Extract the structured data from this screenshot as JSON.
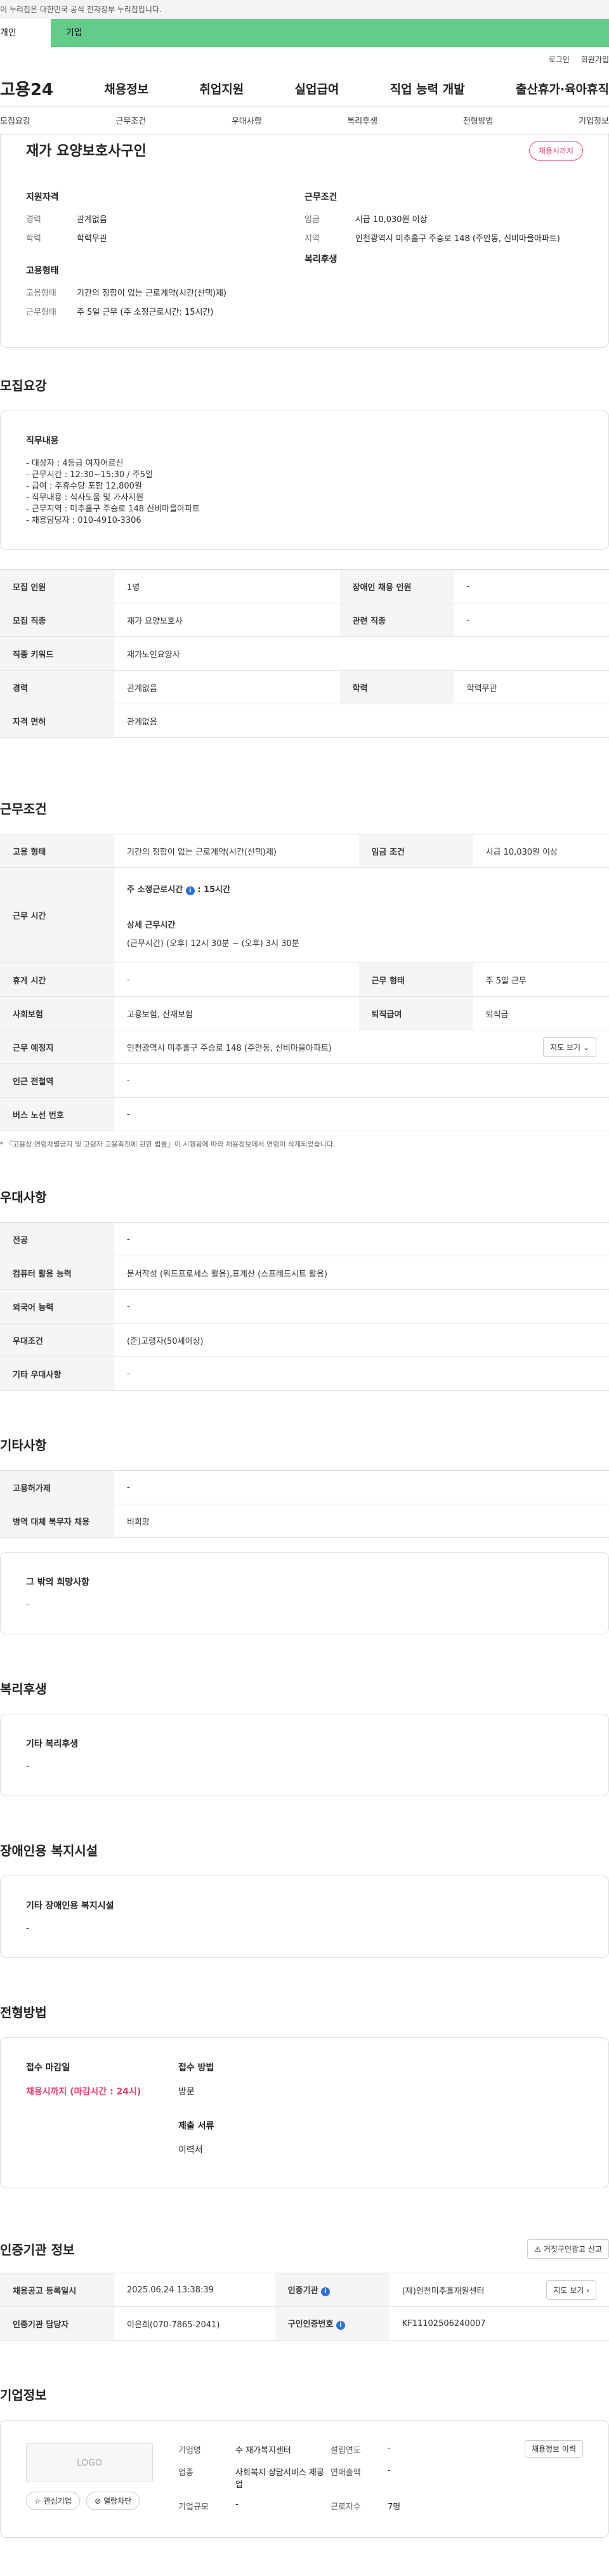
{
  "gov_bar": "이 누리집은 대한민국 공식 전자정부 누리집입니다.",
  "tabs": {
    "personal": "개인",
    "company": "기업"
  },
  "util": {
    "login": "로그인",
    "signup": "회원가입"
  },
  "gnb": {
    "logo": "고용24",
    "items": [
      "채용정보",
      "취업지원",
      "실업급여",
      "직업 능력 개발",
      "출산휴가·육아휴직"
    ]
  },
  "snb": [
    "모집요강",
    "근무조건",
    "우대사항",
    "복리후생",
    "전형방법",
    "기업정보"
  ],
  "summary": {
    "title": "재가 요양보호사구인",
    "badge": "채용시까지",
    "qual_title": "지원자격",
    "qual": [
      {
        "k": "경력",
        "v": "관계없음"
      },
      {
        "k": "학력",
        "v": "학력무관"
      }
    ],
    "cond_title": "근무조건",
    "cond": [
      {
        "k": "임금",
        "v": "시급 10,030원 이상"
      },
      {
        "k": "지역",
        "v": "인천광역시 미추홀구 주승로 148 (주안동, 신비마을아파트)"
      }
    ],
    "emp_title": "고용형태",
    "emp": [
      {
        "k": "고용형태",
        "v": "기간의 정함이 없는 근로계약(시간(선택)제)"
      },
      {
        "k": "근무형태",
        "v": "주 5일 근무 (주 소정근로시간: 15시간)"
      }
    ],
    "welfare_title": "복리후생"
  },
  "recruit": {
    "section": "모집요강",
    "desc_title": "직무내용",
    "desc_lines": [
      "- 대상자 : 4등급 여자어르신",
      "- 근무시간 : 12:30~15:30 / 주5일",
      "- 급여 : 주휴수당 포함 12,800원",
      "- 직무내용 :  식사도움 및 가사지원",
      "- 근무지역 : 미추홀구 주승로 148 신비마을아파트",
      "- 채용담당자 : 010-4910-3306"
    ],
    "table": {
      "headcount_k": "모집 인원",
      "headcount_v": "1명",
      "disabled_k": "장애인 채용 인원",
      "disabled_v": "-",
      "job_k": "모집 직종",
      "job_v": "재가 요양보호사",
      "related_k": "관련 직종",
      "related_v": "-",
      "keyword_k": "직종 키워드",
      "keyword_v": "재가노인요양사",
      "career_k": "경력",
      "career_v": "관계없음",
      "edu_k": "학력",
      "edu_v": "학력무관",
      "license_k": "자격 면허",
      "license_v": "관계없음"
    }
  },
  "work": {
    "section": "근무조건",
    "emp_k": "고용 형태",
    "emp_v": "기간의 정함이 없는 근로계약(시간(선택)제)",
    "wage_k": "임금 조건",
    "wage_v": "시급 10,030원 이상",
    "hours_k": "근무 시간",
    "weekly_label": "주 소정근로시간",
    "weekly_value": "15시간",
    "detail_label": "상세 근무시간",
    "detail_value": "(근무시간) (오후) 12시 30분 ~ (오후) 3시 30분",
    "break_k": "휴게 시간",
    "break_v": "-",
    "type_k": "근무 형태",
    "type_v": "주 5일 근무",
    "insurance_k": "사회보험",
    "insurance_v": "고용보험, 산재보험",
    "severance_k": "퇴직급여",
    "severance_v": "퇴직금",
    "place_k": "근무 예정지",
    "place_v": "인천광역시 미추홀구 주승로 148 (주안동, 신비마을아파트)",
    "map_btn": "지도 보기",
    "station_k": "인근 전철역",
    "station_v": "-",
    "bus_k": "버스 노선 번호",
    "bus_v": "-",
    "note": "* 『고용상 연령차별금지 및 고령자 고용촉진에 관한 법률』이 시행됨에 따라 채용정보에서 연령이 삭제되었습니다."
  },
  "pref": {
    "section": "우대사항",
    "major_k": "전공",
    "major_v": "-",
    "computer_k": "컴퓨터 활용 능력",
    "computer_v": "문서작성 (워드프로세스 활용),표계산 (스프레드시트 활용)",
    "lang_k": "외국어 능력",
    "lang_v": "-",
    "cond_k": "우대조건",
    "cond_v": "(준)고령자(50세이상)",
    "etc_k": "기타 우대사항",
    "etc_v": "-"
  },
  "other": {
    "section": "기타사항",
    "foreign_k": "고용허가제",
    "foreign_v": "-",
    "military_k": "병역 대체 복무자 채용",
    "military_v": "비희망",
    "wish_title": "그 밖의 희망사항",
    "wish_v": "-"
  },
  "welfare": {
    "section": "복리후생",
    "title": "기타 복리후생",
    "value": "-"
  },
  "facility": {
    "section": "장애인용 복지시설",
    "title": "기타 장애인용 복지시설",
    "value": "-"
  },
  "selection": {
    "section": "전형방법",
    "deadline_label": "접수 마감일",
    "deadline_value": "채용시까지 (마감시간 : 24시)",
    "method_label": "접수 방법",
    "method_value": "방문",
    "docs_label": "제출 서류",
    "docs_value": "이력서"
  },
  "agency": {
    "section": "인증기관 정보",
    "report_btn": "거짓구인광고 신고",
    "reg_k": "채용공고 등록일시",
    "reg_v": "2025.06.24 13:38:39",
    "agency_k": "인증기관",
    "agency_v": "(재)인천미추홀재원센터",
    "map_btn": "지도 보기",
    "manager_k": "인증기관 담당자",
    "manager_v": "이은희(070-7865-2041)",
    "cert_k": "구인인증번호",
    "cert_v": "KF11102506240007"
  },
  "company": {
    "section": "기업정보",
    "logo": "LOGO",
    "fav_btn": "관심기업",
    "block_btn": "열람차단",
    "name_k": "기업명",
    "name_v": "수 재가복지센터",
    "industry_k": "업종",
    "industry_v": "사회복지 상담서비스 제공업",
    "size_k": "기업규모",
    "size_v": "-",
    "year_k": "설립연도",
    "year_v": "-",
    "sales_k": "연매출액",
    "sales_v": "-",
    "emp_k": "근로자수",
    "emp_v": "7명",
    "history_btn": "채용정보 이력"
  }
}
